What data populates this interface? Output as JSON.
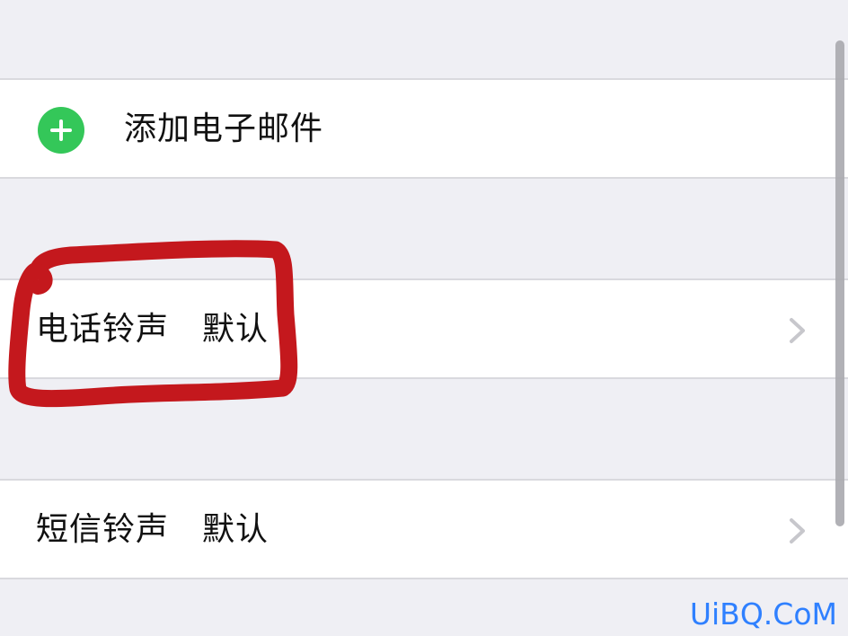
{
  "settings": {
    "add_email_label": "添加电子邮件",
    "ringtone": {
      "label": "电话铃声",
      "value": "默认"
    },
    "sms_tone": {
      "label": "短信铃声",
      "value": "默认"
    }
  },
  "watermark": "UiBQ.CoM",
  "colors": {
    "background": "#efeff4",
    "cell": "#ffffff",
    "add_icon": "#34c759",
    "highlight": "#c4181d",
    "chevron": "#c7c7cc",
    "watermark": "#2f80ff"
  },
  "icons": {
    "add": "plus-circle-icon",
    "disclosure": "chevron-right-icon",
    "scrollbar": "vertical-scrollbar"
  }
}
